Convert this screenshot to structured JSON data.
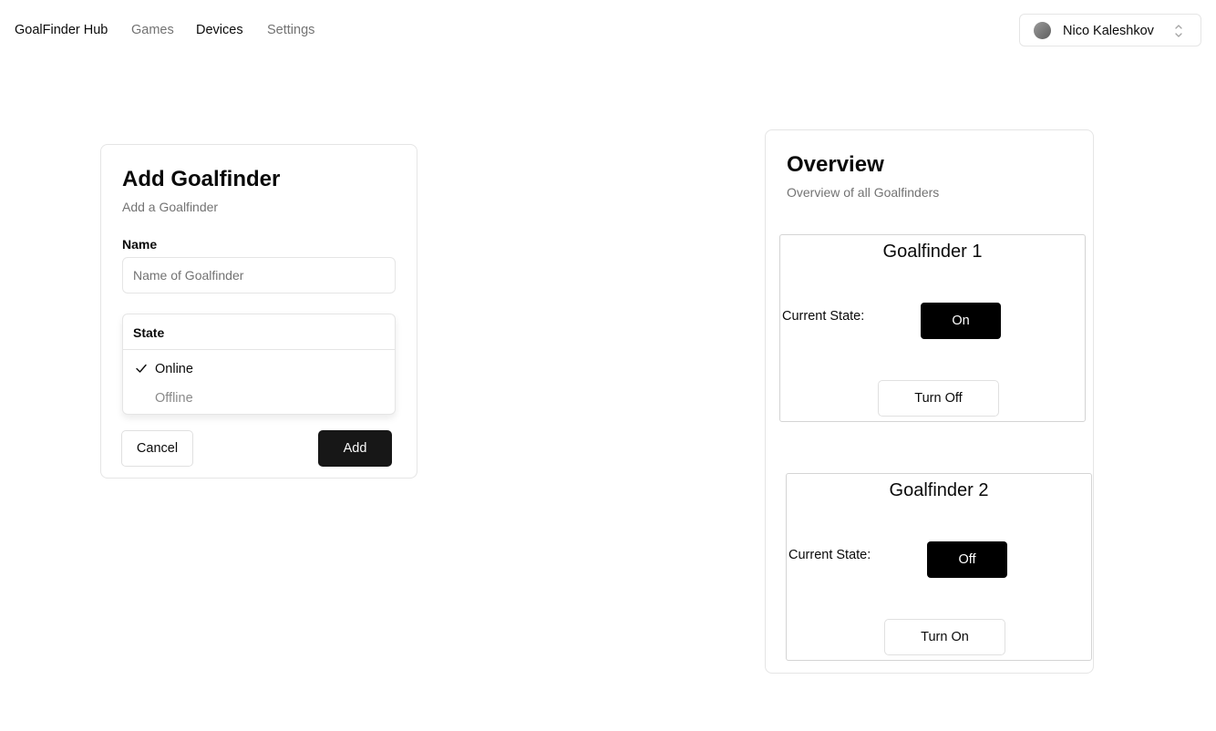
{
  "nav": {
    "brand": "GoalFinder Hub",
    "links": [
      "Games",
      "Devices",
      "Settings"
    ],
    "active": "Devices"
  },
  "user": {
    "name": "Nico Kaleshkov",
    "avatar_icon": "avatar",
    "chevron_icon": "chevron-up-down-icon"
  },
  "add_card": {
    "title": "Add Goalfinder",
    "subtitle": "Add a Goalfinder",
    "name_label": "Name",
    "name_value": "",
    "name_placeholder": "Name of Goalfinder",
    "state_dropdown": {
      "header": "State",
      "options": [
        "Online",
        "Offline"
      ],
      "selected": "Online"
    },
    "cancel_label": "Cancel",
    "add_label": "Add"
  },
  "overview": {
    "title": "Overview",
    "subtitle": "Overview of all Goalfinders",
    "devices": [
      {
        "name": "Goalfinder 1",
        "state_label": "Current State:",
        "state": "On",
        "action": "Turn Off"
      },
      {
        "name": "Goalfinder 2",
        "state_label": "Current State:",
        "state": "Off",
        "action": "Turn On"
      }
    ]
  },
  "colors": {
    "primary": "#171717",
    "border": "#e5e5e5",
    "muted_text": "#737373",
    "state_button": "#000000"
  }
}
